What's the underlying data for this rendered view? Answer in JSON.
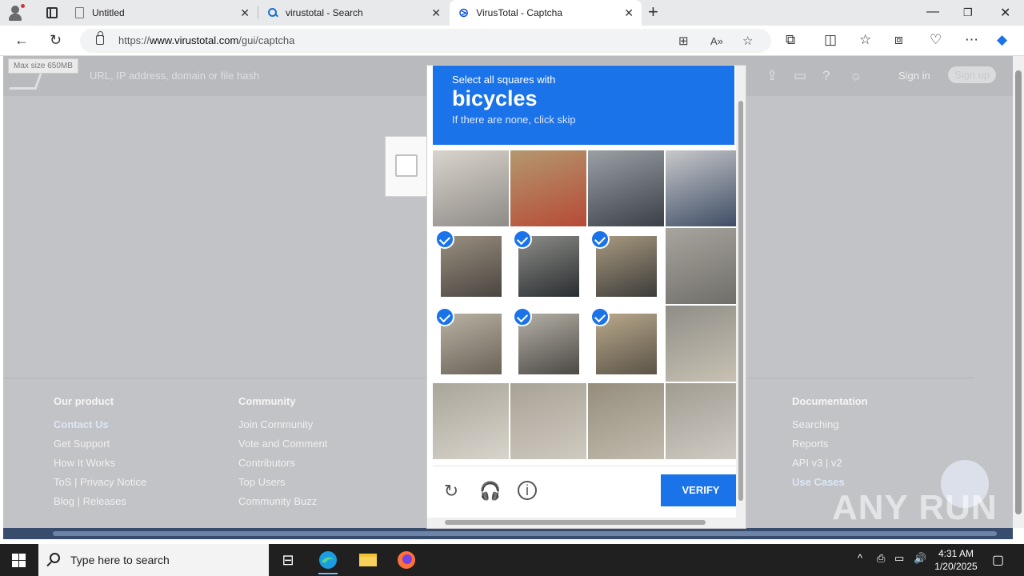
{
  "browser": {
    "tabs": [
      {
        "title": "Untitled"
      },
      {
        "title": "virustotal - Search"
      },
      {
        "title": "VirusTotal - Captcha"
      }
    ],
    "url_prefix": "https://",
    "url_domain": "www.virustotal.com",
    "url_path": "/gui/captcha"
  },
  "page": {
    "tooltip": "Max size 650MB",
    "search_placeholder": "URL, IP address, domain or file hash",
    "sign_in": "Sign in",
    "sign_up": "Sign up",
    "footer": {
      "our_product": {
        "heading": "Our product",
        "links": [
          "Contact Us",
          "Get Support",
          "How It Works",
          "ToS | Privacy Notice",
          "Blog | Releases"
        ]
      },
      "community": {
        "heading": "Community",
        "links": [
          "Join Community",
          "Vote and Comment",
          "Contributors",
          "Top Users",
          "Community Buzz"
        ]
      },
      "documentation": {
        "heading": "Documentation",
        "links": [
          "Searching",
          "Reports",
          "API v3 | v2",
          "Use Cases"
        ]
      }
    },
    "watermark": "ANY RUN"
  },
  "captcha": {
    "instruction": "Select all squares with",
    "target": "bicycles",
    "hint": "If there are none, click skip",
    "verify_label": "VERIFY",
    "selected_tiles": [
      4,
      5,
      6,
      8,
      9,
      10
    ],
    "tile_count": 16
  },
  "taskbar": {
    "search_text": "Type here to search",
    "time": "4:31 AM",
    "date": "1/20/2025"
  }
}
